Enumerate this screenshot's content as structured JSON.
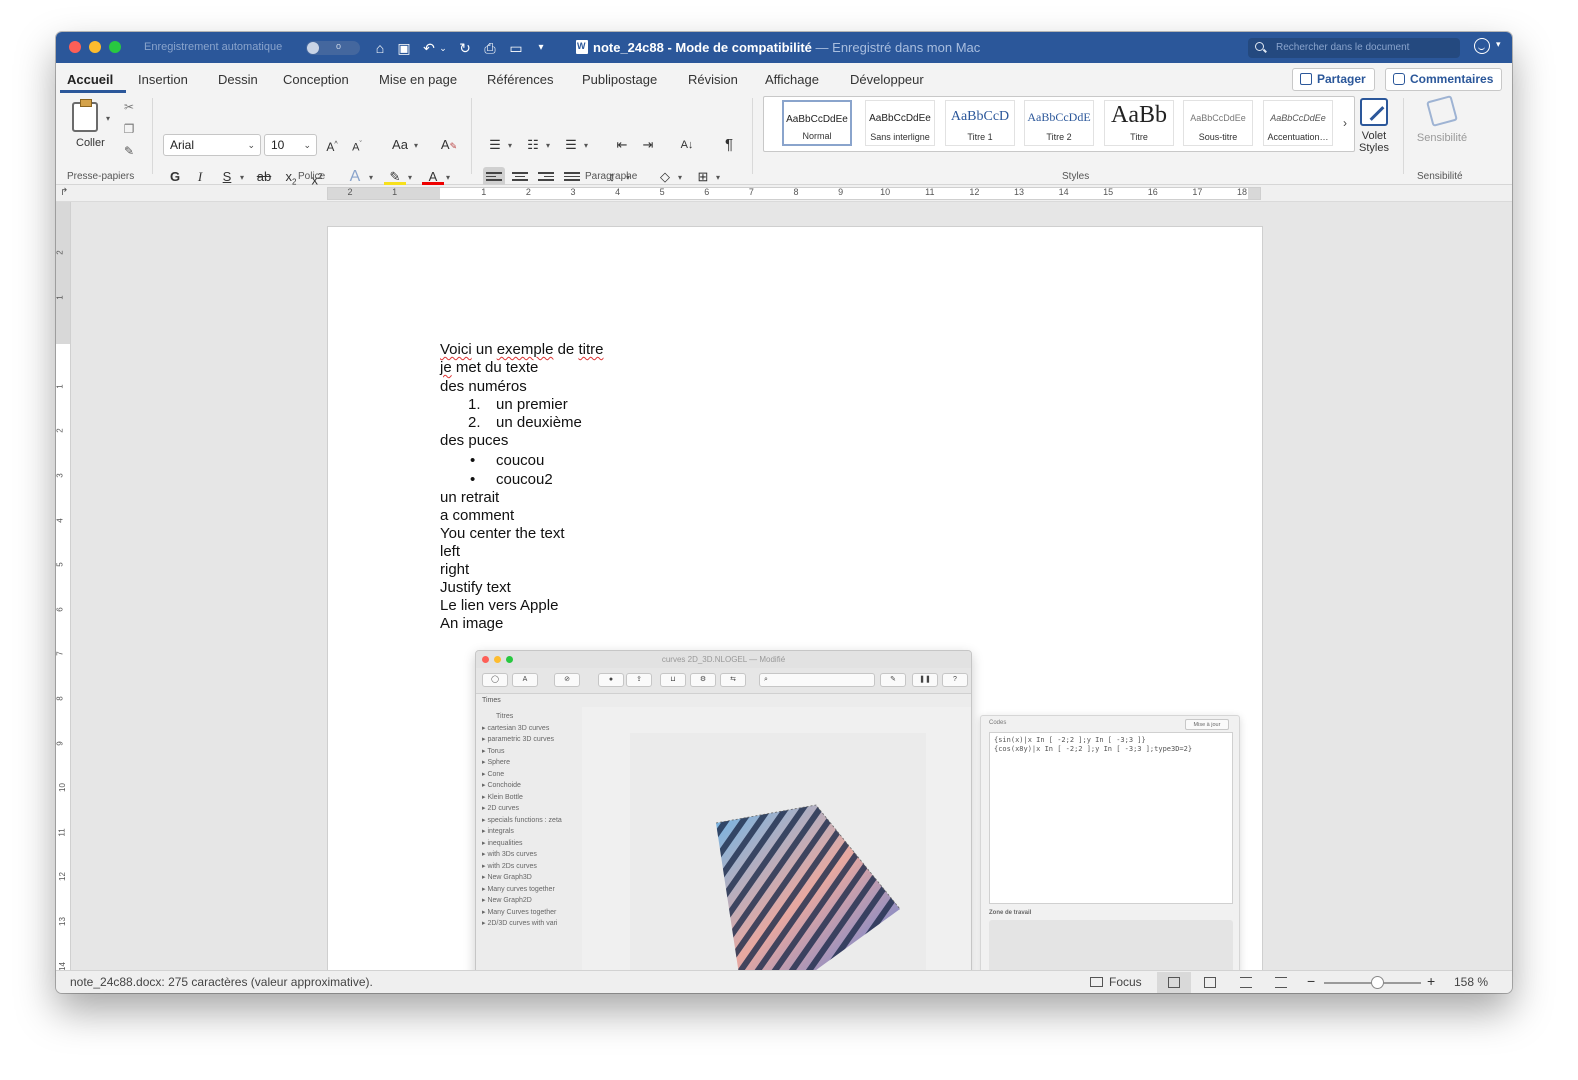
{
  "titlebar": {
    "autosave_label": "Enregistrement automatique",
    "autosave_toggle": "o",
    "doc_name": "note_24c88",
    "mode": "Mode de compatibilité",
    "saved": "— Enregistré dans mon Mac",
    "search_placeholder": "Rechercher dans le document"
  },
  "tabs": [
    "Accueil",
    "Insertion",
    "Dessin",
    "Conception",
    "Mise en page",
    "Références",
    "Publipostage",
    "Révision",
    "Affichage",
    "Développeur"
  ],
  "share_label": "Partager",
  "comments_label": "Commentaires",
  "ribbon": {
    "coller": "Coller",
    "font_name": "Arial",
    "font_size": "10",
    "styles": [
      {
        "preview": "AaBbCcDdEe",
        "name": "Normal"
      },
      {
        "preview": "AaBbCcDdEe",
        "name": "Sans interligne"
      },
      {
        "preview": "AaBbCcD",
        "name": "Titre 1"
      },
      {
        "preview": "AaBbCcDdE",
        "name": "Titre 2"
      },
      {
        "preview": "AaBb",
        "name": "Titre"
      },
      {
        "preview": "AaBbCcDdEe",
        "name": "Sous-titre"
      },
      {
        "preview": "AaBbCcDdEe",
        "name": "Accentuation…"
      }
    ],
    "volet_styles": "Volet Styles",
    "sensibilite": "Sensibilité",
    "groups": {
      "presse_papiers": "Presse-papiers",
      "police": "Police",
      "paragraphe": "Paragraphe",
      "styles": "Styles",
      "sensibilite": "Sensibilité"
    }
  },
  "ruler_numbers": [
    "2",
    "1",
    "1",
    "2",
    "3",
    "4",
    "5",
    "6",
    "7",
    "8",
    "9",
    "10",
    "11",
    "12",
    "13",
    "14",
    "15",
    "16",
    "17",
    "18"
  ],
  "vruler_numbers": [
    "2",
    "1",
    "1",
    "2",
    "3",
    "4",
    "5",
    "6",
    "7",
    "8",
    "9",
    "10",
    "11",
    "12",
    "13",
    "14"
  ],
  "document": {
    "title_word1": "Voici",
    "title_mid": " un ",
    "title_word2": "exemple",
    "title_mid2": " de ",
    "title_word3": "titre",
    "line2_word": "je",
    "line2_rest": " met du texte",
    "numbers_intro": "des numéros",
    "numbered": [
      {
        "marker": "1.",
        "text": "un premier"
      },
      {
        "marker": "2.",
        "text": "un deuxième"
      }
    ],
    "bullets_intro": "des puces",
    "bullets": [
      {
        "marker": "•",
        "text": "coucou"
      },
      {
        "marker": "•",
        "text": "coucou2"
      }
    ],
    "lines": [
      "un retrait",
      "a comment",
      "You center the text",
      "left",
      "right",
      "Justify text",
      "Le lien vers Apple",
      "An image"
    ]
  },
  "embedded_image": {
    "window_title": "curves 2D_3D.NLOGEL — Modifié",
    "font": "Times",
    "sidebar": [
      "Titres",
      "cartesian 3D curves",
      "parametric 3D curves",
      "Torus",
      "Sphere",
      "Cone",
      "Conchoide",
      "Klein Bottle",
      "2D curves",
      "specials functions : zeta",
      "integrals",
      "inequalities",
      "with 3Ds curves",
      "with 2Ds curves",
      "New Graph3D",
      "Many curves together",
      "New Graph2D",
      "Many Curves together",
      "2D/3D curves with vari"
    ],
    "code_header": "Codes",
    "code_button": "Mise à jour",
    "code_lines": [
      "{sin(x)|x In [ -2;2 ];y In [ -3;3 ]}",
      "{cos(x8y)|x In [ -2;2 ];y In [ -3;3 ];type3D=2}"
    ],
    "zone_label": "Zone de travail"
  },
  "status": {
    "text": "note_24c88.docx: 275 caractères (valeur approximative).",
    "focus": "Focus",
    "zoom": "158 %",
    "zoom_level_percent": 158
  },
  "colors": {
    "accent": "#2b579a",
    "titlebar": "#2b579a"
  }
}
